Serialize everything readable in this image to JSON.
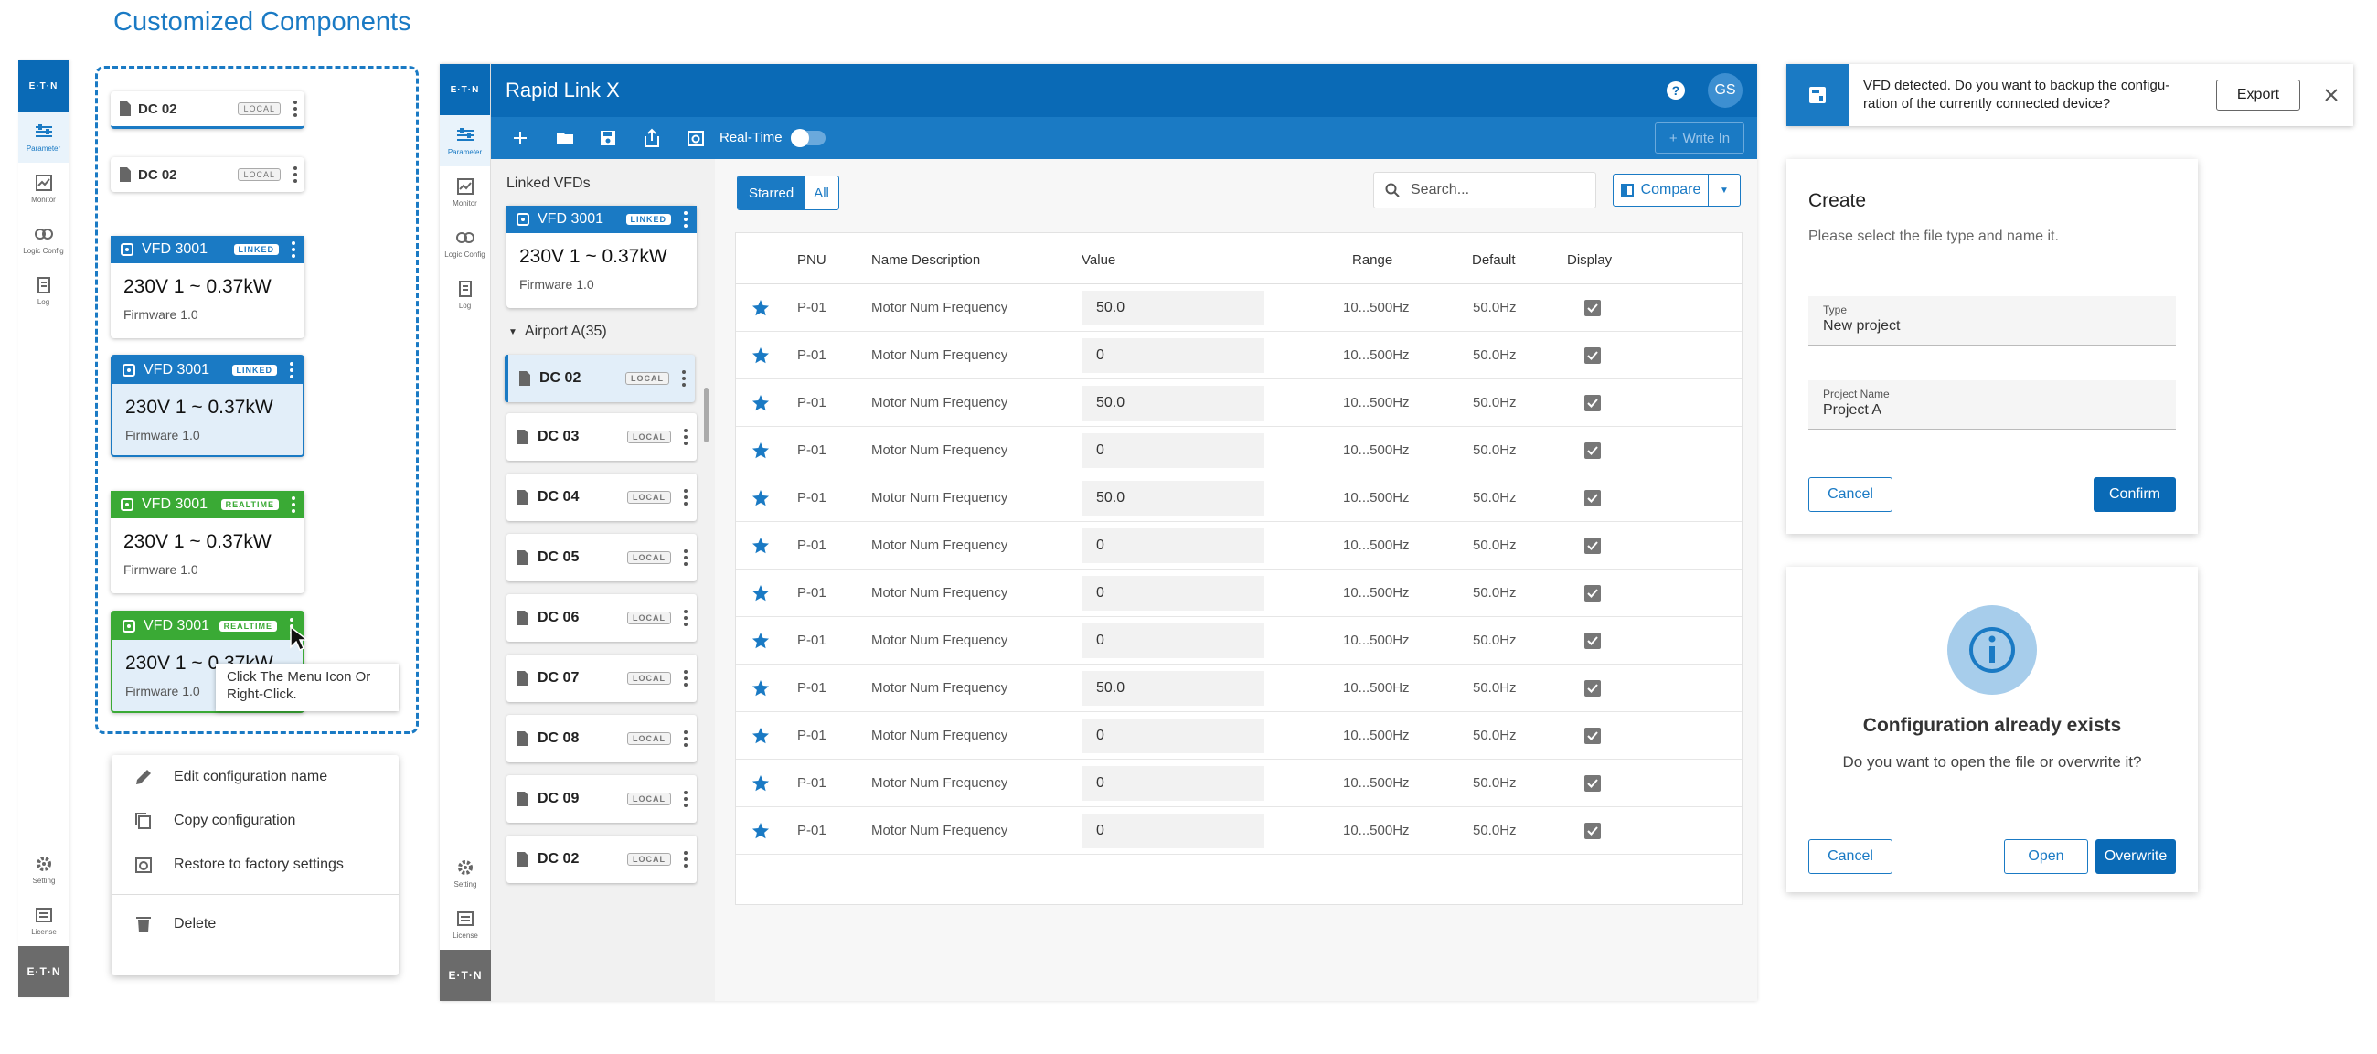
{
  "page_title": "Customized Components",
  "left_rail": {
    "logo": "E·T·N",
    "items": [
      {
        "label": "Parameter",
        "icon": "sliders-icon",
        "active": true
      },
      {
        "label": "Monitor",
        "icon": "chart-icon"
      },
      {
        "label": "Logic Config",
        "icon": "logic-icon"
      },
      {
        "label": "Log",
        "icon": "log-icon"
      }
    ],
    "bottom_items": [
      {
        "label": "Setting",
        "icon": "gear-icon"
      },
      {
        "label": "License",
        "icon": "license-icon"
      }
    ],
    "footer_logo": "E·T·N"
  },
  "components": {
    "local_card_1": {
      "name": "DC 02",
      "tag": "LOCAL"
    },
    "local_card_2": {
      "name": "DC 02",
      "tag": "LOCAL"
    },
    "linked_card_1": {
      "name": "VFD 3001",
      "tag": "LINKED",
      "spec": "230V 1 ~  0.37kW",
      "firmware": "Firmware 1.0"
    },
    "linked_card_2": {
      "name": "VFD 3001",
      "tag": "LINKED",
      "spec": "230V 1 ~  0.37kW",
      "firmware": "Firmware 1.0"
    },
    "realtime_card_1": {
      "name": "VFD 3001",
      "tag": "REALTIME",
      "spec": "230V 1 ~  0.37kW",
      "firmware": "Firmware 1.0"
    },
    "realtime_card_2": {
      "name": "VFD 3001",
      "tag": "REALTIME",
      "spec": "230V 1 ~  0.37kW",
      "firmware": "Firmware 1.0"
    },
    "tooltip": "Click The Menu Icon Or Right-Click.",
    "context_menu": [
      {
        "label": "Edit configuration name",
        "icon": "pencil-icon"
      },
      {
        "label": "Copy configuration",
        "icon": "copy-icon"
      },
      {
        "label": "Restore to factory settings",
        "icon": "restore-icon"
      },
      {
        "label": "Delete",
        "icon": "trash-icon"
      }
    ]
  },
  "app": {
    "title": "Rapid Link X",
    "help_icon": "help-icon",
    "avatar": "GS",
    "toolbar": {
      "realtime_label": "Real-Time",
      "write_in": "Write In"
    },
    "linked_heading": "Linked VFDs",
    "linked_card": {
      "name": "VFD 3001",
      "tag": "LINKED",
      "spec": "230V 1 ~  0.37kW",
      "firmware": "Firmware 1.0"
    },
    "group_label": "Airport A(35)",
    "devices": [
      {
        "name": "DC 02",
        "tag": "LOCAL"
      },
      {
        "name": "DC 03",
        "tag": "LOCAL"
      },
      {
        "name": "DC 04",
        "tag": "LOCAL"
      },
      {
        "name": "DC 05",
        "tag": "LOCAL"
      },
      {
        "name": "DC 06",
        "tag": "LOCAL"
      },
      {
        "name": "DC 07",
        "tag": "LOCAL"
      },
      {
        "name": "DC 08",
        "tag": "LOCAL"
      },
      {
        "name": "DC 09",
        "tag": "LOCAL"
      },
      {
        "name": "DC 02",
        "tag": "LOCAL"
      }
    ],
    "filter_tabs": [
      "Starred",
      "All"
    ],
    "search_placeholder": "Search...",
    "compare_label": "Compare",
    "table": {
      "headers": [
        "PNU",
        "Name Description",
        "Value",
        "Range",
        "Default",
        "Display"
      ],
      "rows": [
        {
          "pnu": "P-01",
          "name": "Motor Num Frequency",
          "value": "50.0",
          "range": "10...500Hz",
          "default": "50.0Hz"
        },
        {
          "pnu": "P-01",
          "name": "Motor Num Frequency",
          "value": "0",
          "range": "10...500Hz",
          "default": "50.0Hz"
        },
        {
          "pnu": "P-01",
          "name": "Motor Num Frequency",
          "value": "50.0",
          "range": "10...500Hz",
          "default": "50.0Hz"
        },
        {
          "pnu": "P-01",
          "name": "Motor Num Frequency",
          "value": "0",
          "range": "10...500Hz",
          "default": "50.0Hz"
        },
        {
          "pnu": "P-01",
          "name": "Motor Num Frequency",
          "value": "50.0",
          "range": "10...500Hz",
          "default": "50.0Hz"
        },
        {
          "pnu": "P-01",
          "name": "Motor Num Frequency",
          "value": "0",
          "range": "10...500Hz",
          "default": "50.0Hz"
        },
        {
          "pnu": "P-01",
          "name": "Motor Num Frequency",
          "value": "0",
          "range": "10...500Hz",
          "default": "50.0Hz"
        },
        {
          "pnu": "P-01",
          "name": "Motor Num Frequency",
          "value": "0",
          "range": "10...500Hz",
          "default": "50.0Hz"
        },
        {
          "pnu": "P-01",
          "name": "Motor Num Frequency",
          "value": "50.0",
          "range": "10...500Hz",
          "default": "50.0Hz"
        },
        {
          "pnu": "P-01",
          "name": "Motor Num Frequency",
          "value": "0",
          "range": "10...500Hz",
          "default": "50.0Hz"
        },
        {
          "pnu": "P-01",
          "name": "Motor Num Frequency",
          "value": "0",
          "range": "10...500Hz",
          "default": "50.0Hz"
        },
        {
          "pnu": "P-01",
          "name": "Motor Num Frequency",
          "value": "0",
          "range": "10...500Hz",
          "default": "50.0Hz"
        }
      ]
    }
  },
  "banner": {
    "text": "VFD detected. Do you want to backup the configu-ration of the currently connected device?",
    "button": "Export"
  },
  "create_dialog": {
    "title": "Create",
    "subtitle": "Please select the file type and name it.",
    "type_label": "Type",
    "type_value": "New project",
    "name_label": "Project Name",
    "name_value": "Project A",
    "cancel": "Cancel",
    "confirm": "Confirm"
  },
  "exists_dialog": {
    "title": "Configuration already exists",
    "message": "Do you want to open the file or overwrite it?",
    "cancel": "Cancel",
    "open": "Open",
    "overwrite": "Overwrite"
  },
  "colors": {
    "primary": "#0a6ab6",
    "accent": "#1a7ac4",
    "realtime": "#3aaa35",
    "star": "#1a7ac4"
  }
}
